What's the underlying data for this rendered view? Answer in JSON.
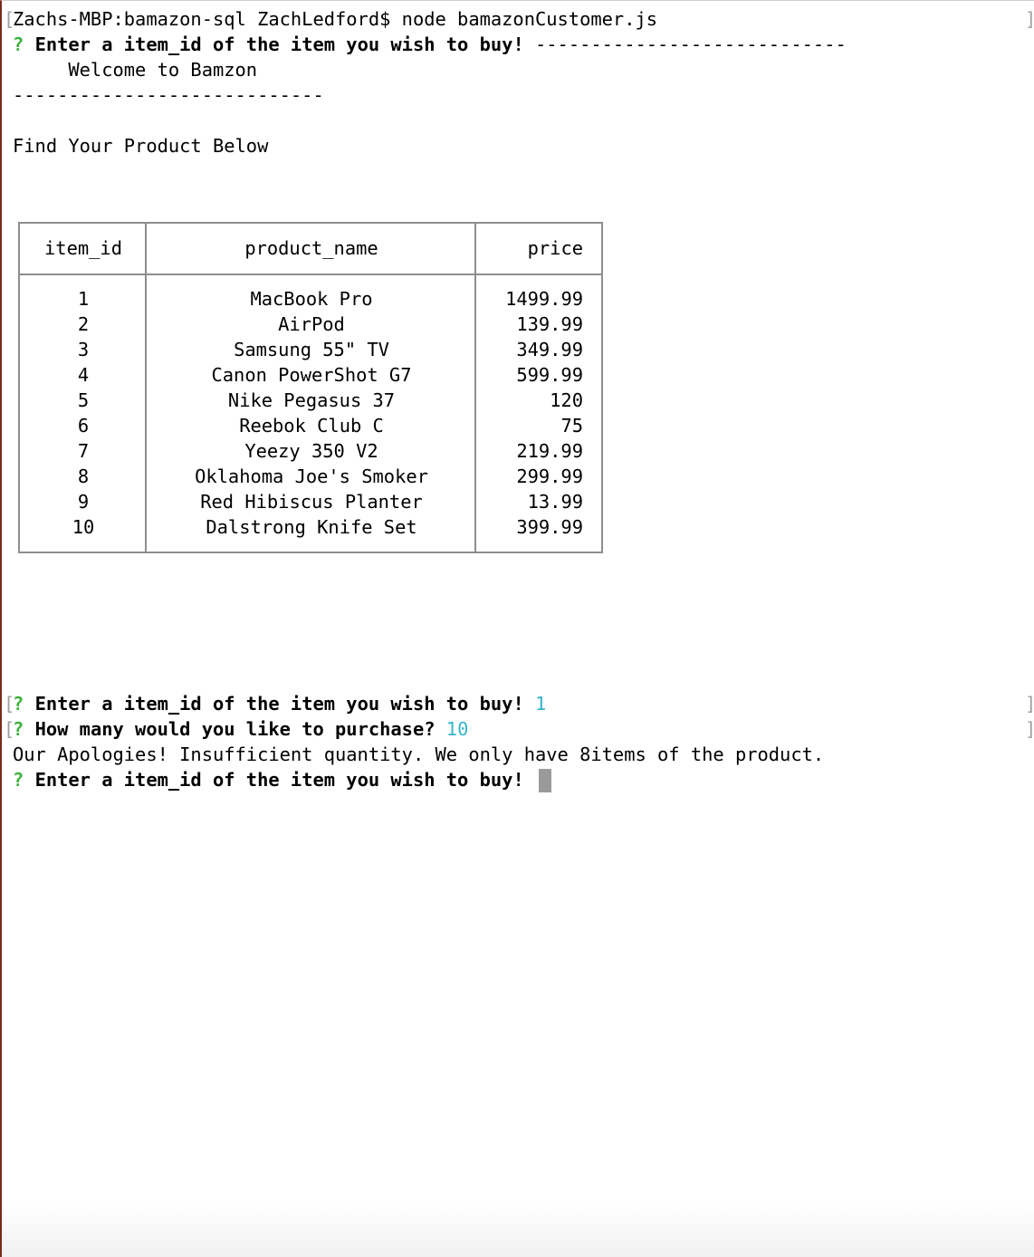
{
  "terminal": {
    "command_line": "Zachs-MBP:bamazon-sql ZachLedford$ node bamazonCustomer.js",
    "bracket_open": "[",
    "bracket_close": "]",
    "question_mark": "?",
    "first_prompt": "Enter a item_id of the item you wish to buy! ",
    "divider_inline": "----------------------------",
    "welcome": "     Welcome to Bamzon",
    "divider": "----------------------------",
    "find_text": "Find Your Product Below",
    "prompt_item": "Enter a item_id of the item you wish to buy! ",
    "answer_item": "1",
    "prompt_quantity": "How many would you like to purchase? ",
    "answer_quantity": "10",
    "error_message": "Our Apologies! Insufficient quantity. We only have 8items of the product.",
    "final_prompt": "Enter a item_id of the item you wish to buy! "
  },
  "table": {
    "headers": [
      "item_id",
      "product_name",
      "price"
    ],
    "rows": [
      {
        "item_id": "1",
        "product_name": "MacBook Pro",
        "price": "1499.99"
      },
      {
        "item_id": "2",
        "product_name": "AirPod",
        "price": "139.99"
      },
      {
        "item_id": "3",
        "product_name": "Samsung 55\" TV",
        "price": "349.99"
      },
      {
        "item_id": "4",
        "product_name": "Canon PowerShot G7",
        "price": "599.99"
      },
      {
        "item_id": "5",
        "product_name": "Nike Pegasus 37",
        "price": "120"
      },
      {
        "item_id": "6",
        "product_name": "Reebok Club C",
        "price": "75"
      },
      {
        "item_id": "7",
        "product_name": "Yeezy 350 V2",
        "price": "219.99"
      },
      {
        "item_id": "8",
        "product_name": "Oklahoma Joe's Smoker",
        "price": "299.99"
      },
      {
        "item_id": "9",
        "product_name": "Red Hibiscus Planter",
        "price": "13.99"
      },
      {
        "item_id": "10",
        "product_name": "Dalstrong Knife Set",
        "price": "399.99"
      }
    ]
  },
  "colors": {
    "prompt_question": "#3db33d",
    "answer": "#36b6c9",
    "table_border": "#8e8e8e",
    "cursor": "#9a9a9a"
  }
}
